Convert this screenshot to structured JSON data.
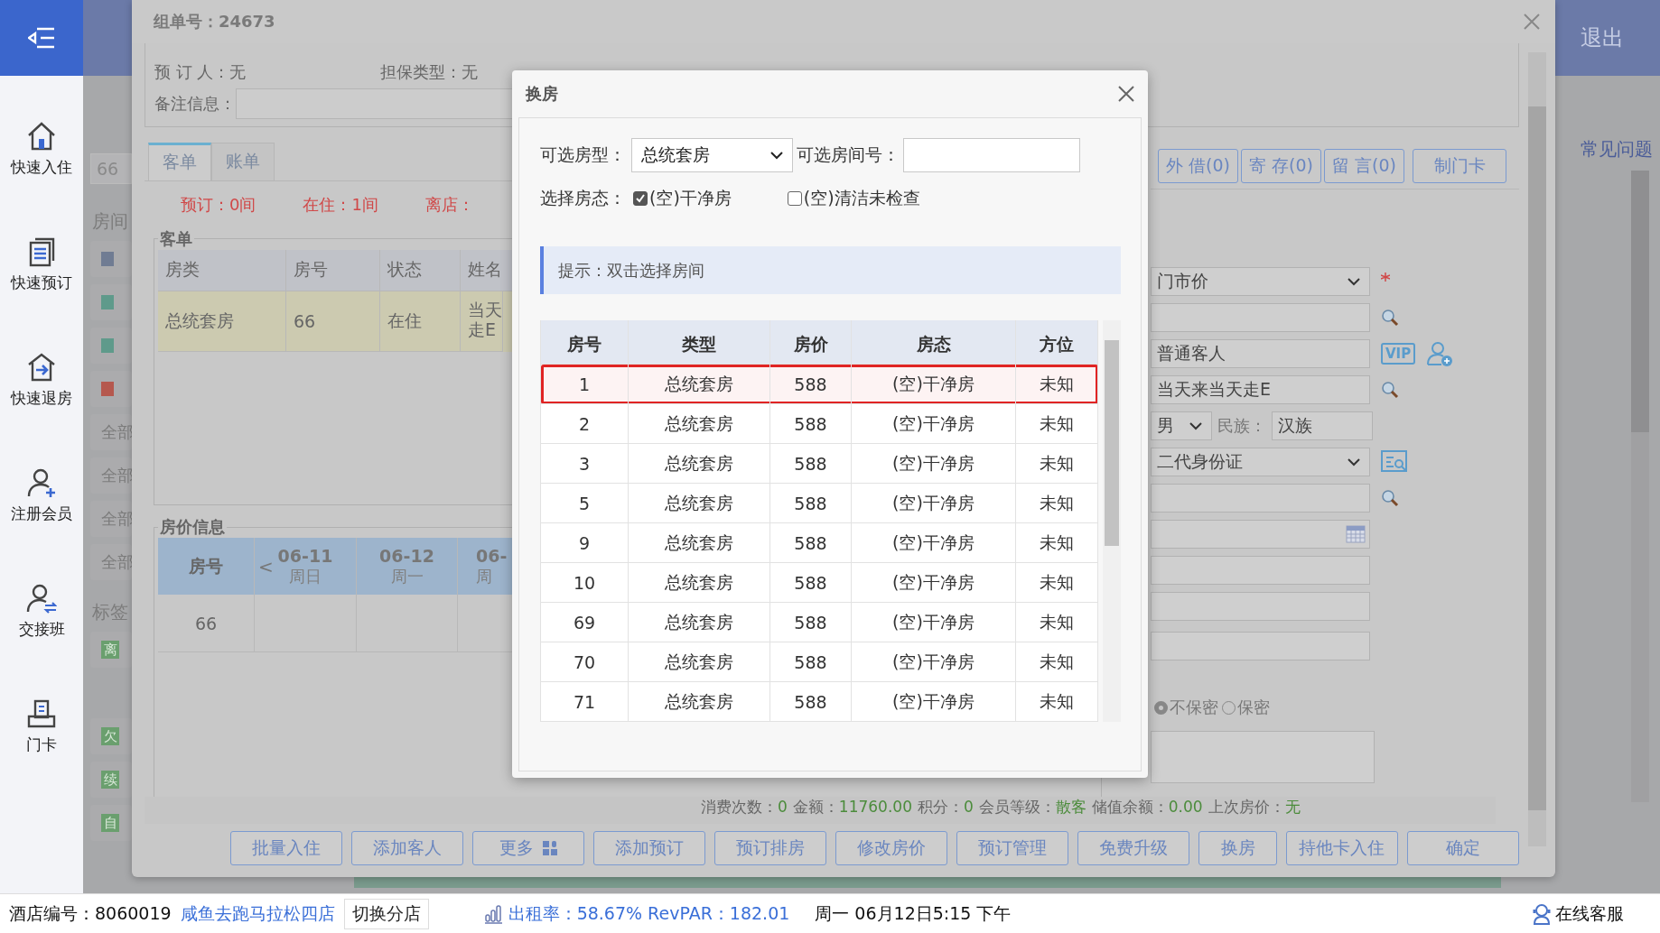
{
  "sidebar": {
    "items": [
      {
        "label": "快速入住"
      },
      {
        "label": "快速预订"
      },
      {
        "label": "快速退房"
      },
      {
        "label": "注册会员"
      },
      {
        "label": "交接班"
      },
      {
        "label": "门卡"
      }
    ]
  },
  "top_bar": {
    "logout": "退出",
    "help": "常见问题"
  },
  "side_panel": {
    "room_field": "66",
    "rooms_label": "房间",
    "swatches": [
      {
        "color": "#707c93"
      },
      {
        "color": "#5f9a8b"
      },
      {
        "color": "#5f9a8b"
      },
      {
        "color": "#b5584e"
      }
    ],
    "filters": [
      "全部",
      "全部",
      "全部",
      "全部"
    ],
    "tags_label": "标签",
    "tags": [
      "离",
      "欠",
      "续",
      "自"
    ]
  },
  "order_dialog": {
    "title": "组单号：24673",
    "info": [
      {
        "label": "预 订 人：",
        "value": "无"
      },
      {
        "label": "担保类型：",
        "value": "无"
      }
    ],
    "remark_label": "备注信息：",
    "tabs": [
      {
        "label": "客单",
        "selected": true
      },
      {
        "label": "账单",
        "selected": false
      }
    ],
    "counts": [
      "预订：0间",
      "在住：1间",
      "离店："
    ],
    "guest_table": {
      "title": "客单",
      "columns": [
        "房类",
        "房号",
        "状态",
        "姓名"
      ],
      "rows": [
        {
          "cells": [
            "总统套房",
            "66",
            "在住",
            "当天走E"
          ],
          "selected": true
        }
      ]
    },
    "price_info": {
      "title": "房价信息",
      "room_header": "房号",
      "prev": "<",
      "dates": [
        {
          "date": "06-11",
          "weekday": "周日"
        },
        {
          "date": "06-12",
          "weekday": "周一"
        },
        {
          "date": "06-",
          "weekday": "周"
        }
      ],
      "rows": [
        "66"
      ]
    },
    "side_buttons": [
      "外 借(0)",
      "寄 存(0)",
      "留 言(0)",
      "制门卡"
    ],
    "form": {
      "fields": [
        {
          "kind": "select",
          "value": "门市价",
          "required": true
        },
        {
          "kind": "search"
        },
        {
          "kind": "member",
          "value": "普通客人",
          "badge": "VIP"
        },
        {
          "kind": "search",
          "value": "当天来当天走E"
        },
        {
          "kind": "gender",
          "value": "男",
          "label": "民族：",
          "extra": "汉族"
        },
        {
          "kind": "id",
          "value": "二代身份证"
        },
        {
          "kind": "search"
        },
        {
          "kind": "date"
        },
        {
          "kind": "text"
        },
        {
          "kind": "text"
        },
        {
          "kind": "text"
        }
      ],
      "privacy": [
        {
          "label": "不保密",
          "selected": true
        },
        {
          "label": "保密",
          "selected": false
        }
      ]
    },
    "member_info": [
      {
        "label": "消费次数：",
        "value": "0"
      },
      {
        "label": "金额：",
        "value": "11760.00"
      },
      {
        "label": "积分：",
        "value": "0"
      },
      {
        "label": "会员等级：",
        "value": "散客"
      },
      {
        "label": "储值余额：",
        "value": "0.00"
      },
      {
        "label": "上次房价：",
        "value": "无"
      }
    ],
    "buttons": [
      {
        "label": "批量入住",
        "kind": "plain"
      },
      {
        "label": "添加客人",
        "kind": "plain"
      },
      {
        "label": "更多",
        "kind": "menu"
      },
      {
        "label": "添加预订",
        "kind": "plain"
      },
      {
        "label": "预订排房",
        "kind": "plain"
      },
      {
        "label": "修改房价",
        "kind": "plain"
      },
      {
        "label": "预订管理",
        "kind": "plain"
      },
      {
        "label": "免费升级",
        "kind": "plain"
      },
      {
        "label": "换房",
        "kind": "plain"
      },
      {
        "label": "持他卡入住",
        "kind": "plain"
      },
      {
        "label": "确定",
        "kind": "plain"
      }
    ]
  },
  "modal": {
    "title": "换房",
    "type_label": "可选房型：",
    "type_value": "总统套房",
    "room_label": "可选房间号：",
    "status_label": "选择房态：",
    "statuses": [
      {
        "label": "(空)干净房",
        "checked": true
      },
      {
        "label": "(空)清洁未检查",
        "checked": false
      }
    ],
    "hint": "提示：双击选择房间",
    "columns": [
      "房号",
      "类型",
      "房价",
      "房态",
      "方位"
    ],
    "rows": [
      {
        "cells": [
          "1",
          "总统套房",
          "588",
          "(空)干净房",
          "未知"
        ],
        "selected": true
      },
      {
        "cells": [
          "2",
          "总统套房",
          "588",
          "(空)干净房",
          "未知"
        ],
        "selected": false
      },
      {
        "cells": [
          "3",
          "总统套房",
          "588",
          "(空)干净房",
          "未知"
        ],
        "selected": false
      },
      {
        "cells": [
          "5",
          "总统套房",
          "588",
          "(空)干净房",
          "未知"
        ],
        "selected": false
      },
      {
        "cells": [
          "9",
          "总统套房",
          "588",
          "(空)干净房",
          "未知"
        ],
        "selected": false
      },
      {
        "cells": [
          "10",
          "总统套房",
          "588",
          "(空)干净房",
          "未知"
        ],
        "selected": false
      },
      {
        "cells": [
          "69",
          "总统套房",
          "588",
          "(空)干净房",
          "未知"
        ],
        "selected": false
      },
      {
        "cells": [
          "70",
          "总统套房",
          "588",
          "(空)干净房",
          "未知"
        ],
        "selected": false
      },
      {
        "cells": [
          "71",
          "总统套房",
          "588",
          "(空)干净房",
          "未知"
        ],
        "selected": false
      }
    ]
  },
  "status_bar": {
    "hotel": "酒店编号：8060019",
    "store": "咸鱼去跑马拉松四店",
    "switch": "切换分店",
    "occupancy": "出租率：58.67% RevPAR：182.01",
    "datetime": "周一 06月12日5:15 下午",
    "service": "在线客服"
  }
}
